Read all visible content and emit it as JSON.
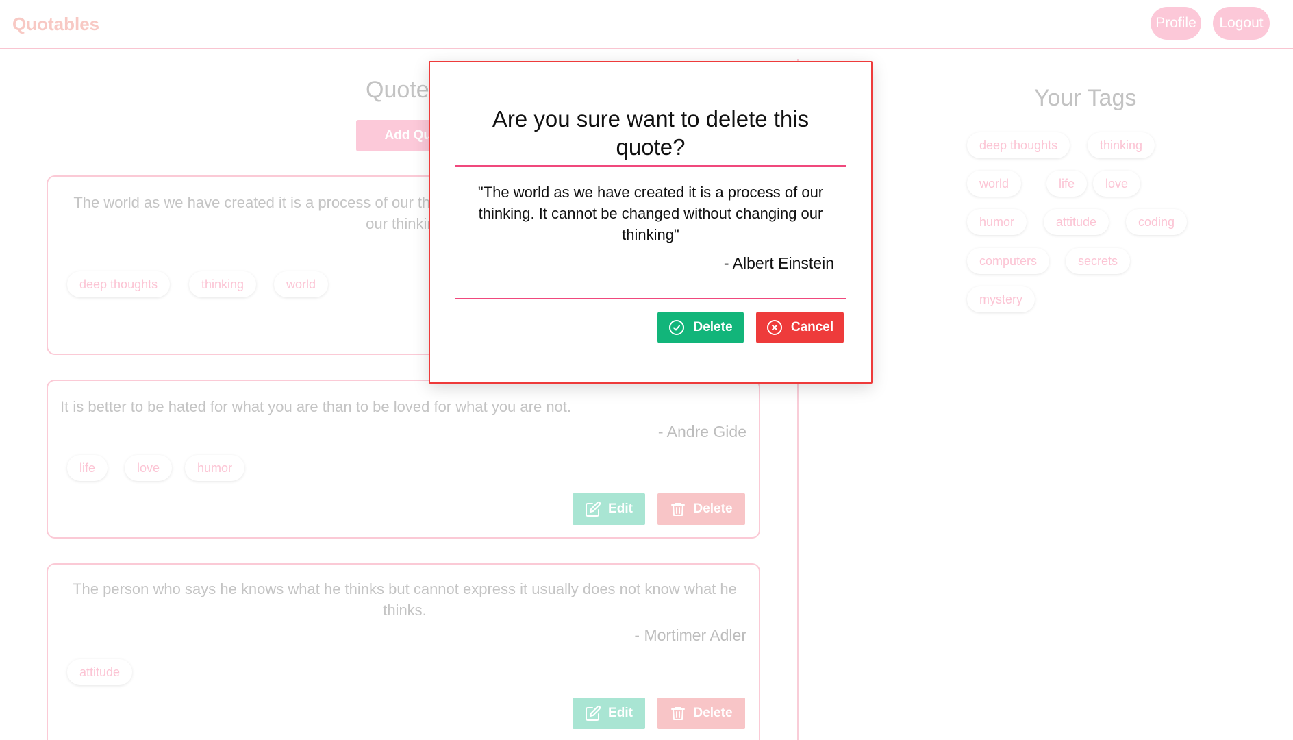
{
  "nav": {
    "brand": "Quotables",
    "profile_label": "Profile",
    "logout_label": "Logout"
  },
  "main": {
    "heading": "Quotes",
    "add_quote_label": "Add Quote",
    "quotes": [
      {
        "text": "The world as we have created it is a process of our thinking. It cannot be changed without changing our thinking",
        "author": "",
        "tags": [
          "deep thoughts",
          "thinking",
          "world"
        ]
      },
      {
        "text": "It is better to be hated for what you are than to be loved for what you are not.",
        "author": "- Andre Gide",
        "tags": [
          "life",
          "love",
          "humor"
        ],
        "edit_label": "Edit",
        "delete_label": "Delete"
      },
      {
        "text": "The person who says he knows what he thinks but cannot express it usually does not know what he thinks.",
        "author": "- Mortimer Adler",
        "tags": [
          "attitude"
        ],
        "edit_label": "Edit",
        "delete_label": "Delete"
      }
    ]
  },
  "sidebar": {
    "heading": "Your Tags",
    "tags": [
      "deep thoughts",
      "thinking",
      "world",
      "life",
      "love",
      "humor",
      "attitude",
      "coding",
      "computers",
      "secrets",
      "mystery"
    ]
  },
  "modal": {
    "title": "Are you sure want to delete this quote?",
    "quote": "\"The world as we have created it is a process of our thinking. It cannot be changed without changing our thinking\"",
    "author": "- Albert Einstein",
    "delete_label": "Delete",
    "cancel_label": "Cancel"
  },
  "colors": {
    "accent_pink": "#f0497d",
    "danger_red": "#ee3b3b",
    "success_green": "#12b57a"
  }
}
